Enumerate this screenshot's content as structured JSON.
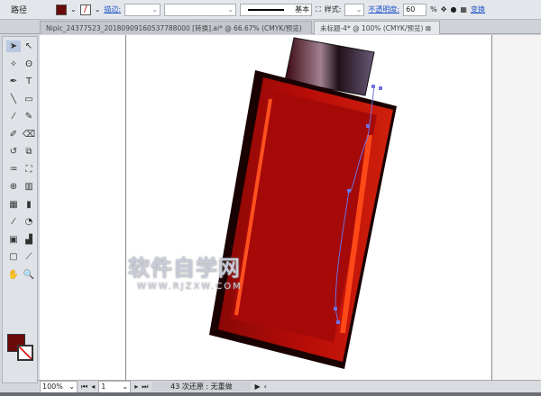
{
  "control_bar": {
    "object_type": "路径",
    "fill_color": "#6b0a0a",
    "stroke_label": "描边:",
    "style_label": "基本",
    "styles_label": "样式:",
    "opacity_label": "不透明度:",
    "opacity_value": "60",
    "opacity_unit": "%",
    "transform_label": "变换"
  },
  "tabs": [
    {
      "label": "Nipic_24377523_20180909160537788000 [转换].ai* @ 66.67% (CMYK/预览)",
      "active": false
    },
    {
      "label": "未标题-4* @ 100% (CMYK/预览)",
      "active": true
    }
  ],
  "tools": [
    "selection",
    "direct-selection",
    "magic-wand",
    "lasso",
    "pen",
    "type",
    "line",
    "rectangle",
    "paintbrush",
    "pencil",
    "blob-brush",
    "eraser",
    "rotate",
    "scale",
    "warp",
    "free-transform",
    "shape-builder",
    "perspective",
    "mesh",
    "gradient",
    "eyedropper",
    "blend",
    "symbol-sprayer",
    "column-graph",
    "artboard",
    "slice",
    "hand",
    "zoom"
  ],
  "colors": {
    "fill": "#6b0a0a",
    "bottle_red": "#c01008",
    "accent": "#2255cc"
  },
  "status": {
    "zoom": "100%",
    "page": "1",
    "message": "43 次还原 : 无重做"
  },
  "watermark": {
    "title": "软件自学网",
    "url": "WWW.RJZXW.COM"
  }
}
